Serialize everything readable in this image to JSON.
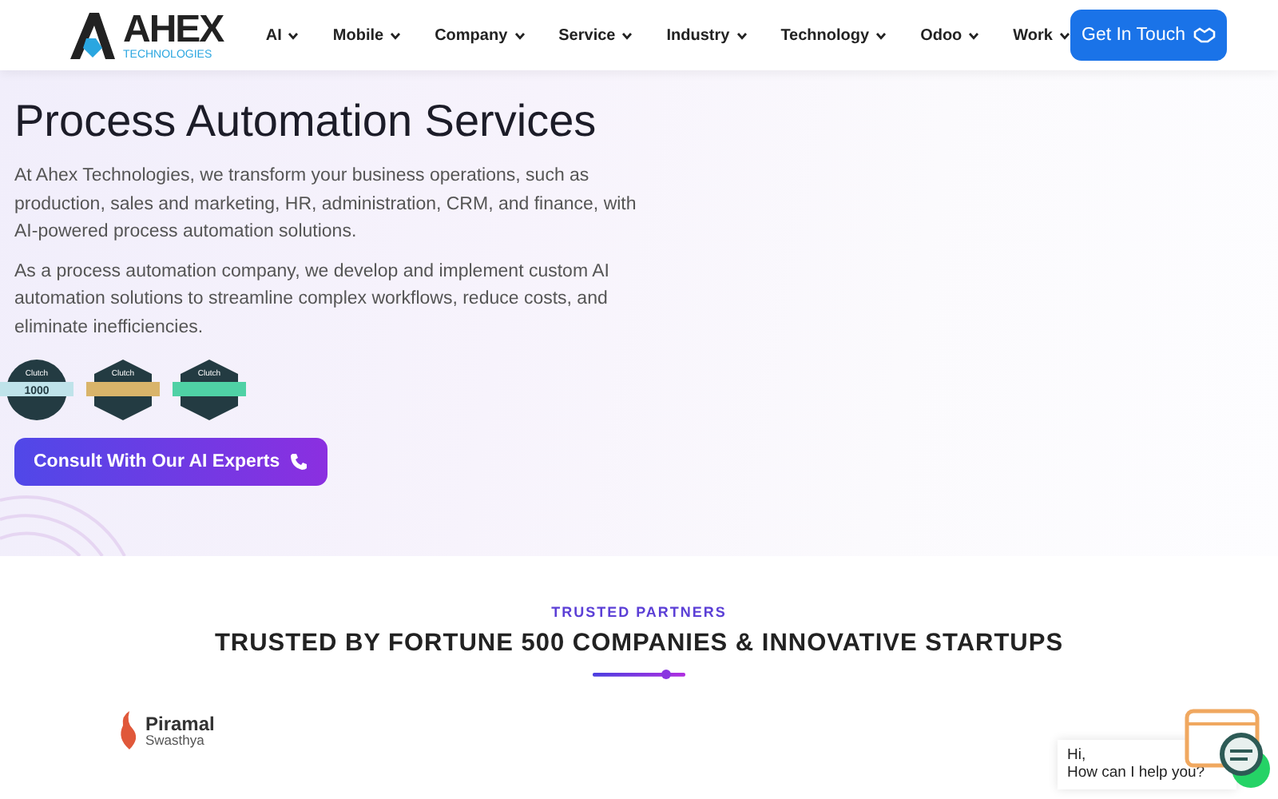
{
  "logo": {
    "name": "AHEX",
    "subtitle": "TECHNOLOGIES"
  },
  "nav": [
    {
      "label": "AI"
    },
    {
      "label": "Mobile"
    },
    {
      "label": "Company"
    },
    {
      "label": "Service"
    },
    {
      "label": "Industry"
    },
    {
      "label": "Technology"
    },
    {
      "label": "Odoo"
    },
    {
      "label": "Work"
    }
  ],
  "cta": {
    "label": "Get In Touch"
  },
  "hero": {
    "title": "Process Automation Services",
    "paragraphs": [
      "At Ahex Technologies, we transform your business operations, such as production, sales and marketing, HR, administration, CRM, and finance, with AI-powered process automation solutions.",
      "As a process automation company, we develop and implement custom AI automation solutions to streamline complex workflows, reduce costs, and eliminate inefficiencies."
    ],
    "badges": [
      {
        "label": "Clutch",
        "value": "1000",
        "kind": "circle",
        "color": "#bfe3ea"
      },
      {
        "label": "Clutch",
        "kind": "hexagon",
        "color": "#d9b46a"
      },
      {
        "label": "Clutch",
        "kind": "hexagon",
        "color": "#4fd1a5"
      }
    ],
    "button": "Consult With Our AI Experts"
  },
  "partners": {
    "eyebrow": "TRUSTED PARTNERS",
    "title": "TRUSTED BY FORTUNE 500 COMPANIES & INNOVATIVE STARTUPS",
    "logos": [
      {
        "name": "Piramal",
        "sub": "Swasthya"
      }
    ]
  },
  "chat": {
    "lines": [
      "Hi,",
      "How can I help you?"
    ]
  }
}
